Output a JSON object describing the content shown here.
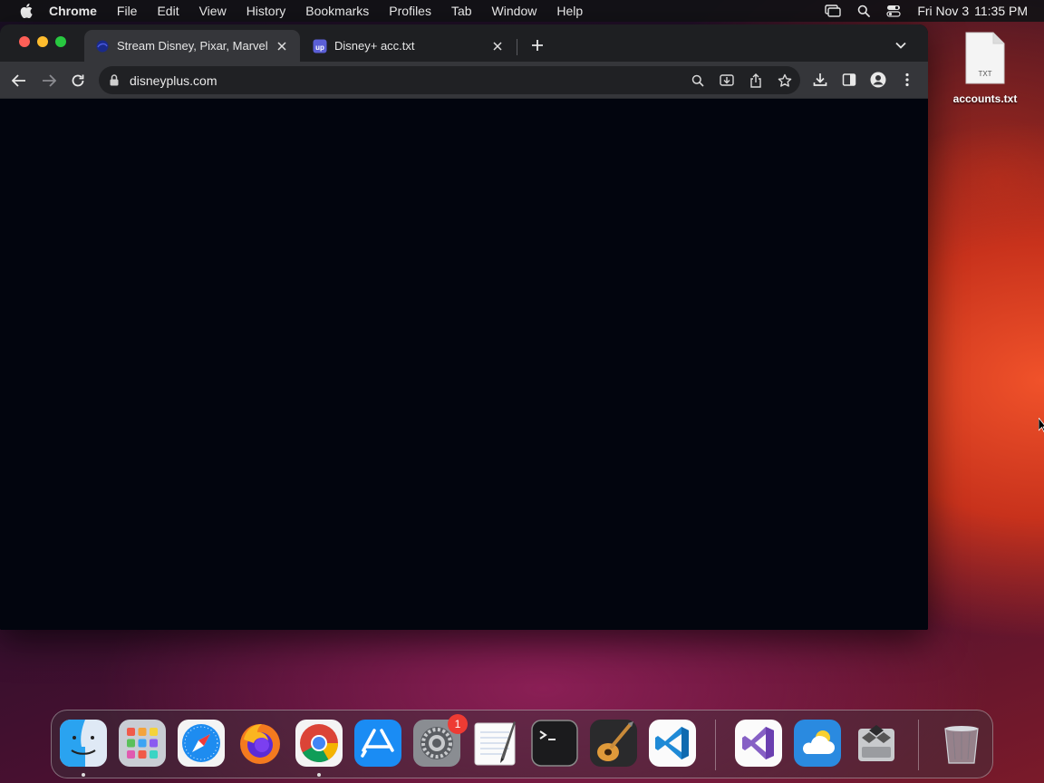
{
  "menubar": {
    "app_name": "Chrome",
    "items": [
      "File",
      "Edit",
      "View",
      "History",
      "Bookmarks",
      "Profiles",
      "Tab",
      "Window",
      "Help"
    ],
    "date": "Fri Nov 3",
    "time": "11:35 PM"
  },
  "browser": {
    "tabs": [
      {
        "title": "Stream Disney, Pixar, Marvel, Star Wars",
        "favicon": "disney-plus-favicon",
        "active": true
      },
      {
        "title": "Disney+ acc.txt",
        "favicon": "upload-favicon",
        "favicon_text": "up",
        "active": false
      }
    ],
    "address_bar": {
      "url": "disneyplus.com"
    },
    "content_background": "#02050e"
  },
  "desktop": {
    "file": {
      "name": "accounts.txt",
      "type_label": "TXT"
    }
  },
  "dock": {
    "apps": [
      "Finder",
      "Launchpad",
      "Safari",
      "Firefox",
      "Google Chrome",
      "App Store",
      "System Settings",
      "TextEdit",
      "Terminal",
      "GarageBand",
      "Visual Studio Code",
      "Visual Studio",
      "Weather",
      "Boot Camp Assistant",
      "Trash"
    ],
    "system_settings_badge": "1"
  },
  "colors": {
    "menubar": "#121216",
    "tabstrip": "#1e1f22",
    "toolbar": "#35363a",
    "omnibox": "#202124"
  }
}
